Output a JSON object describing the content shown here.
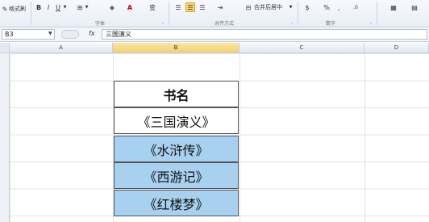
{
  "ribbon": {
    "format_painter": "格式刷",
    "font_group_label": "字体",
    "align_group_label": "对齐方式",
    "number_group_label": "数字",
    "merge_center_label": "合并后居中",
    "percent_symbol": "%",
    "bold": "B",
    "italic": "I",
    "underline": "U",
    "wrap_char": "变"
  },
  "formula_bar": {
    "name_box": "B3",
    "fx": "fx",
    "content": "三国演义"
  },
  "columns": [
    "A",
    "B",
    "C",
    "D"
  ],
  "cells": {
    "header": "书名",
    "rows": [
      "《三国演义》",
      "《水浒传》",
      "《西游记》",
      "《红楼梦》"
    ]
  },
  "colors": {
    "fill": "#a8d1ef",
    "active_col": "#f4cf6e"
  }
}
